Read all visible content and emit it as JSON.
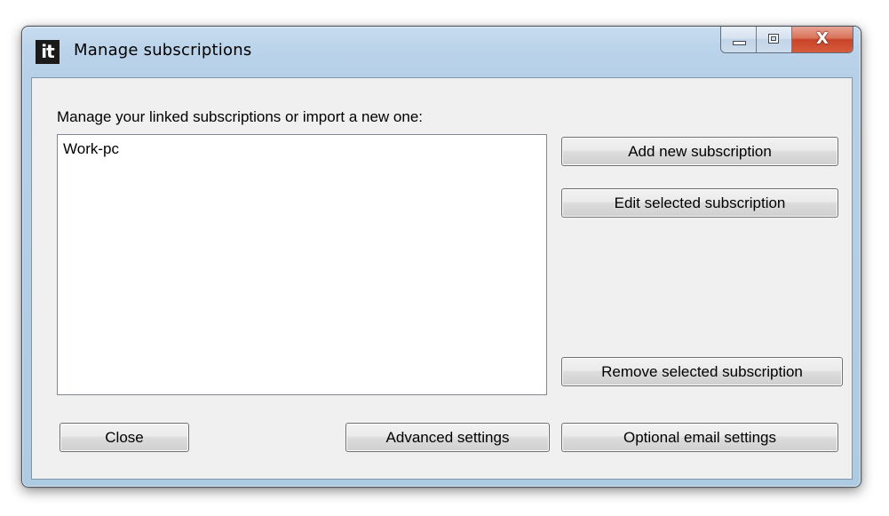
{
  "window": {
    "title": "Manage subscriptions",
    "icon": "it-app-icon",
    "icon_text": "it",
    "caption_buttons": {
      "minimize_icon": "minimize-icon",
      "maximize_icon": "maximize-icon",
      "close_glyph": "X"
    }
  },
  "main": {
    "instruction": "Manage your linked subscriptions or import a new one:",
    "subscriptions": [
      "Work-pc"
    ]
  },
  "buttons": {
    "add": "Add new subscription",
    "edit": "Edit selected subscription",
    "remove": "Remove selected subscription",
    "close": "Close",
    "advanced": "Advanced settings",
    "email": "Optional email settings"
  },
  "colors": {
    "frame": "#b6d0e7",
    "client_bg": "#f0f0f0",
    "close_button": "#c8432a"
  }
}
